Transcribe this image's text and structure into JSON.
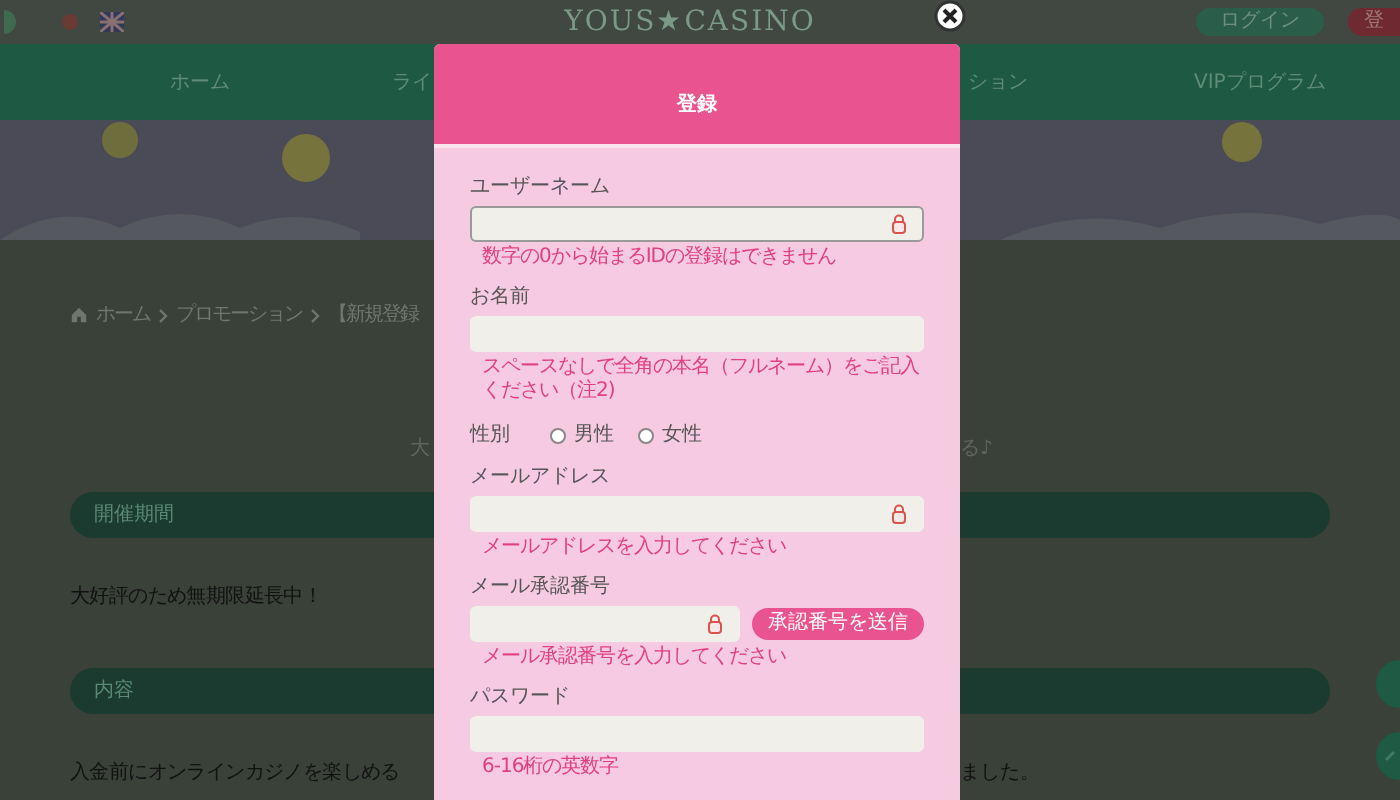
{
  "header": {
    "logo": "YOUS★CASINO",
    "login_button": "ログイン",
    "register_button": "登"
  },
  "nav": {
    "items": [
      {
        "label": "ホーム"
      },
      {
        "label": "ライ"
      },
      {
        "label": "ション"
      },
      {
        "label": "VIPプログラム"
      }
    ]
  },
  "breadcrumb": {
    "items": [
      "ホーム",
      "プロモーション",
      "【新規登録"
    ]
  },
  "page": {
    "intro_left": "大",
    "intro_right": "る♪",
    "sections": [
      {
        "heading": "開催期間",
        "text": "大好評のため無期限延長中！"
      },
      {
        "heading": "内容",
        "text": "入金前にオンラインカジノを楽しめる",
        "text_right": "ました。"
      }
    ]
  },
  "modal": {
    "title": "登録",
    "fields": [
      {
        "kind": "text_lock",
        "label": "ユーザーネーム",
        "hint": "数字の0から始まるIDの登録はできません",
        "focused": true
      },
      {
        "kind": "text",
        "label": "お名前",
        "hint": "スペースなしで全角の本名（フルネーム）をご記入ください（注2)",
        "focused": false
      },
      {
        "kind": "radio",
        "label": "性別",
        "options": [
          {
            "label": "男性",
            "selected": false
          },
          {
            "label": "女性",
            "selected": false
          }
        ]
      },
      {
        "kind": "text_lock",
        "label": "メールアドレス",
        "hint": "メールアドレスを入力してください",
        "focused": false
      },
      {
        "kind": "text_button",
        "label": "メール承認番号",
        "hint": "メール承認番号を入力してください",
        "button": "承認番号を送信",
        "focused": false
      },
      {
        "kind": "text",
        "label": "パスワード",
        "hint": "6-16桁の英数字",
        "focused": false
      }
    ]
  }
}
